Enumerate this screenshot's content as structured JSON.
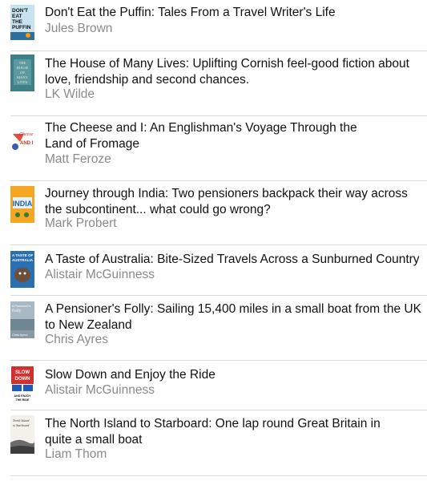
{
  "books": [
    {
      "title": "Don't Eat the Puffin: Tales From a Travel Writer's Life",
      "author": "Jules Brown",
      "cover_icon": "puffin-cover"
    },
    {
      "title": "The House of Many Lives: Uplifting Cornish feel-good fiction about love, friendship and second chances.",
      "author": "LK Wilde",
      "cover_icon": "house-cover"
    },
    {
      "title": "The Cheese and I: An Englishman's Voyage Through the Land of Fromage",
      "author": "Matt Feroze",
      "cover_icon": "cheese-cover"
    },
    {
      "title": "Journey through India: Two pensioners backpack their way across the subcontinent... what could go wrong?",
      "author": "Mark Probert",
      "cover_icon": "india-cover"
    },
    {
      "title": "A Taste of Australia: Bite-Sized Travels Across a Sunburned Country",
      "author": "Alistair McGuinness",
      "cover_icon": "australia-cover"
    },
    {
      "title": "A Pensioner's Folly: Sailing 15,400 miles in a small boat from the UK to New Zealand",
      "author": "Chris Ayres",
      "cover_icon": "folly-cover"
    },
    {
      "title": "Slow Down and Enjoy the Ride",
      "author": "Alistair McGuinness",
      "cover_icon": "slow-down-cover"
    },
    {
      "title": "The North Island to Starboard: One lap round Great Britain in quite a small boat",
      "author": "Liam Thom",
      "cover_icon": "starboard-cover"
    }
  ],
  "covers": {
    "puffin": {
      "line1": "DON'T",
      "line2": "EAT",
      "line3": "THE",
      "line4": "PUFFIN"
    },
    "house": {
      "line1": "THE",
      "line2": "HOUSE",
      "line3": "OF",
      "line4": "MANY",
      "line5": "LIVES"
    },
    "cheese": {
      "line1": "Cheese",
      "line2": "AND I"
    },
    "india": {
      "line1": "INDIA"
    },
    "australia": {
      "line1": "A TASTE OF",
      "line2": "AUSTRALIA"
    },
    "folly": {
      "line1": "A Pensioner's",
      "line2": "Folly",
      "line3": "Chris Ayres"
    },
    "slow": {
      "line1": "SLOW",
      "line2": "DOWN",
      "line3": "AND ENJOY",
      "line4": "THE RIDE"
    },
    "starboard": {
      "line1": "North Island",
      "line2": "to Starboard"
    }
  },
  "colors": {
    "separator": "#d9d9dc",
    "author_text": "#8a8a8e",
    "title_text": "#111111"
  }
}
